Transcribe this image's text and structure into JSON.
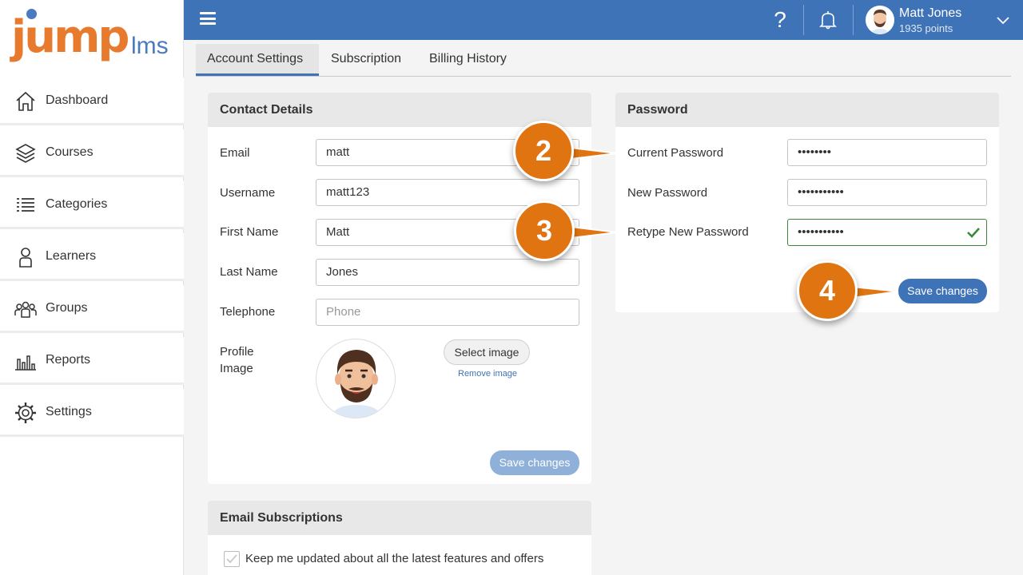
{
  "app": {
    "logo_main": "jump",
    "logo_suffix": "lms"
  },
  "sidebar": {
    "items": [
      {
        "label": "Dashboard",
        "icon": "home-icon"
      },
      {
        "label": "Courses",
        "icon": "courses-icon"
      },
      {
        "label": "Categories",
        "icon": "list-icon"
      },
      {
        "label": "Learners",
        "icon": "user-icon"
      },
      {
        "label": "Groups",
        "icon": "group-icon"
      },
      {
        "label": "Reports",
        "icon": "bar-chart-icon"
      },
      {
        "label": "Settings",
        "icon": "gear-icon"
      }
    ]
  },
  "header": {
    "help_glyph": "?",
    "user_name": "Matt Jones",
    "user_points": "1935 points"
  },
  "tabs": [
    {
      "label": "Account Settings"
    },
    {
      "label": "Subscription"
    },
    {
      "label": "Billing History"
    }
  ],
  "contact": {
    "title": "Contact Details",
    "email_label": "Email",
    "email_value": "matt",
    "username_label": "Username",
    "username_value": "matt123",
    "first_name_label": "First Name",
    "first_name_value": "Matt",
    "last_name_label": "Last Name",
    "last_name_value": "Jones",
    "telephone_label": "Telephone",
    "telephone_placeholder": "Phone",
    "profile_label_1": "Profile",
    "profile_label_2": "Image",
    "select_image": "Select image",
    "remove_image": "Remove image",
    "save": "Save changes"
  },
  "password": {
    "title": "Password",
    "current_label": "Current Password",
    "current_value": "••••••••",
    "new_label": "New Password",
    "new_value": "•••••••••••",
    "retype_label": "Retype New Password",
    "retype_value": "•••••••••••",
    "save": "Save changes"
  },
  "subscriptions": {
    "title": "Email Subscriptions",
    "option_1": "Keep me updated about all the latest features and offers"
  },
  "callouts": [
    "2",
    "3",
    "4"
  ],
  "colors": {
    "accent": "#3f73b8",
    "brand_orange": "#e87a2e",
    "callout": "#e07410",
    "valid": "#3a8a3a"
  }
}
